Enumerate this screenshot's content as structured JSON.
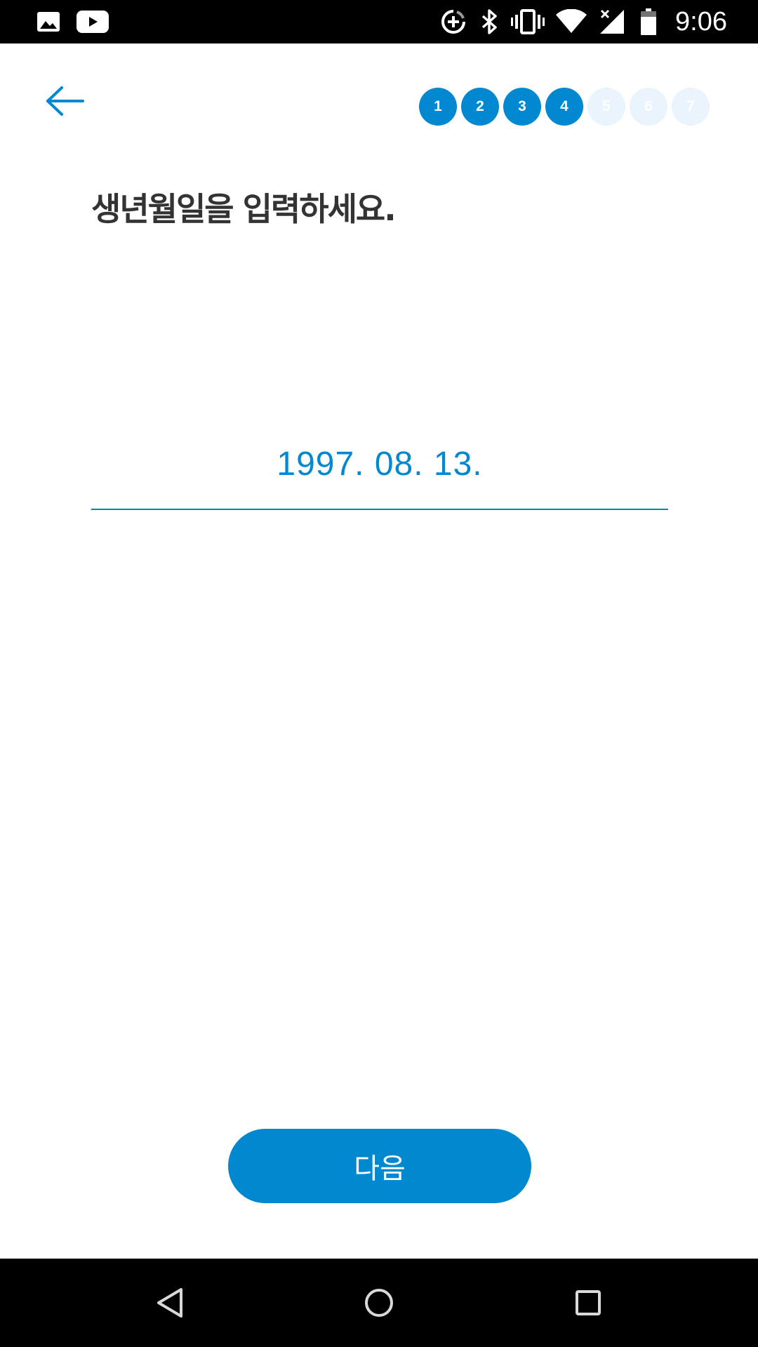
{
  "status_bar": {
    "time": "9:06",
    "left_icons": [
      "image-icon",
      "youtube-icon"
    ],
    "right_icons": [
      "data-saver-icon",
      "bluetooth-icon",
      "vibrate-icon",
      "wifi-icon",
      "no-signal-icon",
      "battery-icon"
    ]
  },
  "header": {
    "back_icon": "arrow-left-icon",
    "steps": [
      {
        "label": "1",
        "state": "done"
      },
      {
        "label": "2",
        "state": "done"
      },
      {
        "label": "3",
        "state": "done"
      },
      {
        "label": "4",
        "state": "done"
      },
      {
        "label": "5",
        "state": "todo"
      },
      {
        "label": "6",
        "state": "todo"
      },
      {
        "label": "7",
        "state": "todo"
      }
    ],
    "current_step": 4,
    "total_steps": 7
  },
  "main": {
    "title": "생년월일을 입력하세요.",
    "birthdate_value": "1997. 08. 13."
  },
  "footer": {
    "next_label": "다음"
  },
  "nav_bar": {
    "buttons": [
      "back-triangle-icon",
      "home-circle-icon",
      "recents-square-icon"
    ]
  },
  "colors": {
    "accent": "#0288d1",
    "step_inactive": "#e9f4fc",
    "title_text": "#333333",
    "status_bar": "#000000"
  }
}
